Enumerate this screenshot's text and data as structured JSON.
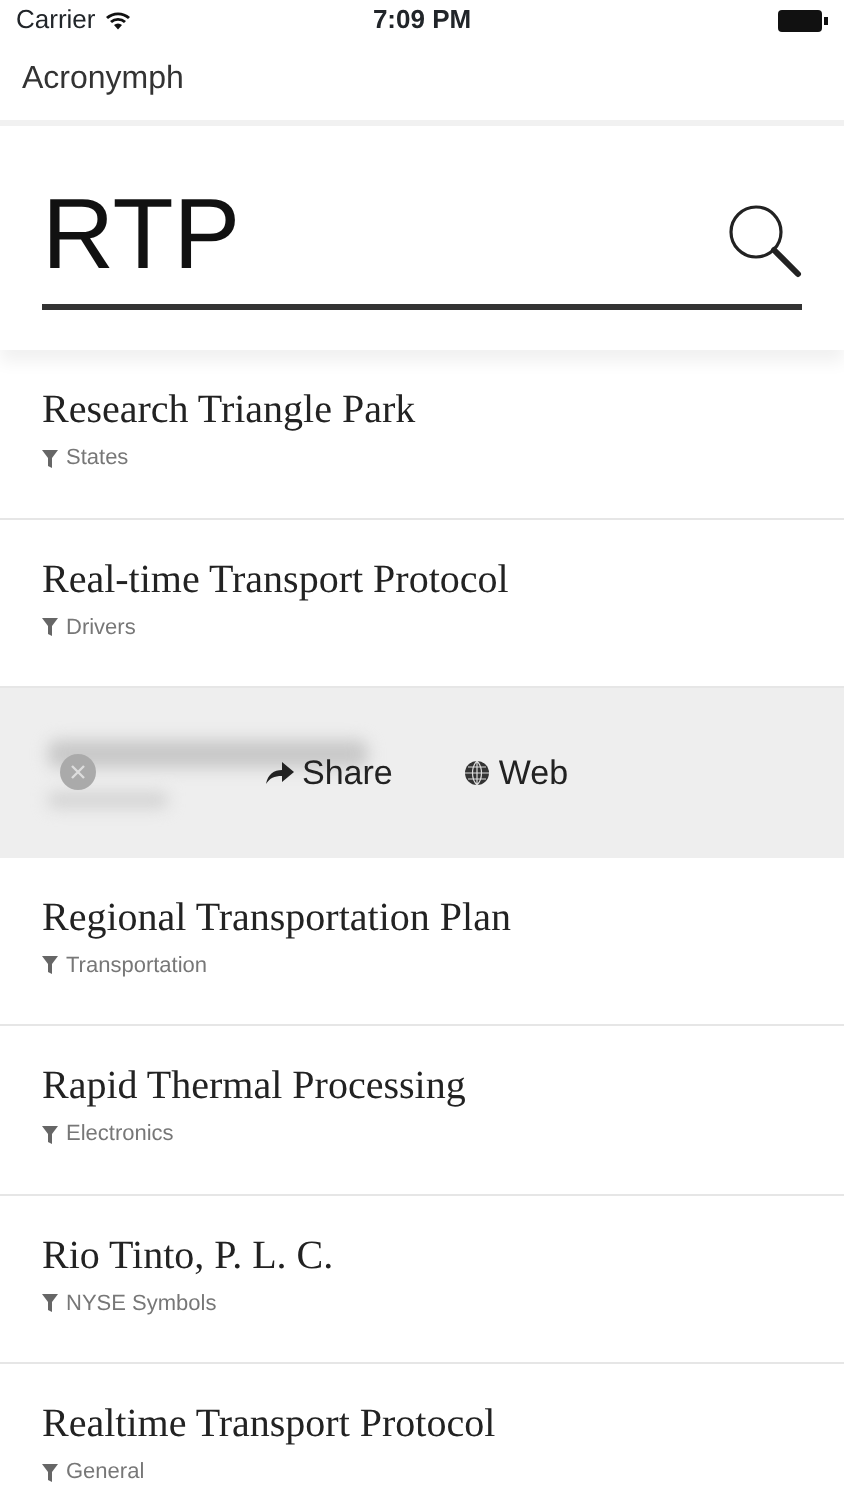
{
  "status_bar": {
    "carrier": "Carrier",
    "time": "7:09 PM"
  },
  "nav": {
    "title": "Acronymph"
  },
  "search": {
    "value": "RTP"
  },
  "results": [
    {
      "kind": "result",
      "title": "Research Triangle Park",
      "category": "States"
    },
    {
      "kind": "result",
      "title": "Real-time Transport Protocol",
      "category": "Drivers"
    },
    {
      "kind": "actions",
      "actions": [
        {
          "kind": "share",
          "label": "Share"
        },
        {
          "kind": "web",
          "label": "Web"
        }
      ]
    },
    {
      "kind": "result",
      "title": "Regional Transportation Plan",
      "category": "Transportation"
    },
    {
      "kind": "result",
      "title": "Rapid Thermal Processing",
      "category": "Electronics"
    },
    {
      "kind": "result",
      "title": "Rio Tinto, P. L. C.",
      "category": "NYSE Symbols"
    },
    {
      "kind": "result",
      "title": "Realtime Transport Protocol",
      "category": "General"
    }
  ]
}
